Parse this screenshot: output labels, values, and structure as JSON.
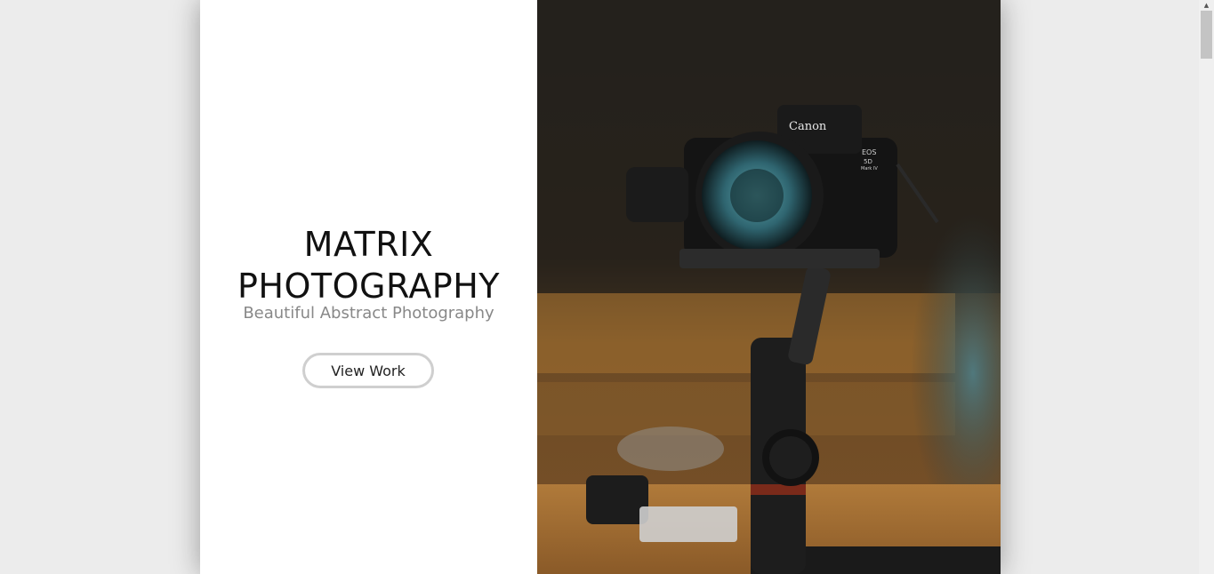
{
  "hero": {
    "title_line1": "MATRIX",
    "title_line2": "PHOTOGRAPHY",
    "subtitle": "Beautiful Abstract Photography",
    "button_label": "View Work"
  },
  "photo": {
    "camera_brand": "Canon",
    "camera_model_line1": "EOS",
    "camera_model_line2": "5D",
    "camera_model_line3": "Mark IV",
    "icon": "camera-photo"
  },
  "colors": {
    "page_background": "#ececec",
    "panel_background": "#ffffff",
    "title_color": "#111111",
    "subtitle_color": "#888888",
    "button_border": "#cfcfcf"
  }
}
